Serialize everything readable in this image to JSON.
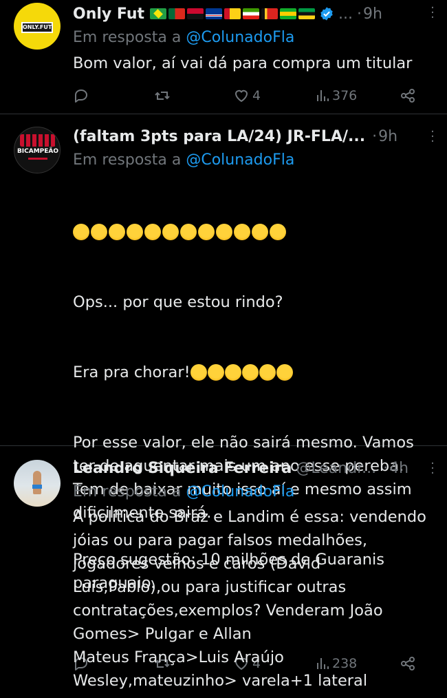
{
  "tweets": [
    {
      "name": "Only Fut",
      "handle": "",
      "time": "9h",
      "reply_prefix": "Em resposta a",
      "reply_to": "@ColunadoFla",
      "text": "Bom valor, aí vai dá para compra um titular",
      "likes": "4",
      "views": "376",
      "avatar_label": "ONLY.FUT"
    },
    {
      "name": "(faltam 3pts para LA/24) JR-FLA/...",
      "handle": "",
      "time": "9h",
      "reply_prefix": "Em resposta a",
      "reply_to": "@ColunadoFla",
      "text_lines": [
        "Ops... por que estou rindo?",
        "Era pra chorar!",
        "Por esse valor, ele não sairá mesmo. Vamos\nter de aguentar mais um ano esse pereba.\nTem de baixar muito isso aí e mesmo assim\ndificilmente sairá.\n\nPreço sugestão: 10 milhões de Guaranis\nparaguaio."
      ],
      "likes": "4",
      "views": "238",
      "avatar_label": "BICAMPEÃO"
    },
    {
      "name": "Leandro Siqueira Ferreira",
      "handle": "@Leandr...",
      "time": "4h",
      "reply_prefix": "Em resposta a",
      "reply_to": "@ColunadoFla",
      "text": "A política do Braz e Landim é essa: vendendo\njóias ou para pagar falsos medalhões,\njogadores velhos e caros (David\nLuis,Pablo),ou para justificar outras\ncontratações,exemplos? Venderam João\nGomes> Pulgar e Allan\nMateus França>Luis Araújo\nWesley,mateuzinho> varela+1 lateral"
    }
  ],
  "colors": {
    "accent": "#1d9bf0",
    "muted": "#71767b",
    "text": "#e7e9ea",
    "bg": "#000000"
  },
  "icons": [
    "reply-icon",
    "retweet-icon",
    "heart-icon",
    "views-icon",
    "share-icon",
    "more-icon",
    "verified-icon"
  ],
  "separator": "·",
  "ellipsis": "..."
}
